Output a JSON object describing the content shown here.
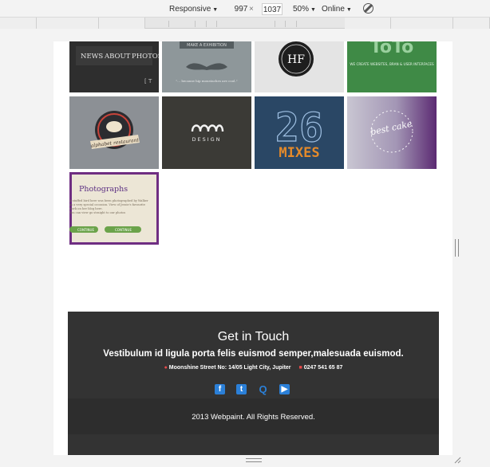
{
  "toolbar": {
    "device": "Responsive",
    "width": "997",
    "separator": "×",
    "height": "1037",
    "zoom": "50%",
    "network": "Online"
  },
  "tiles": {
    "nav_news": "NEWS",
    "nav_about": "ABOUT",
    "nav_photos": "PHOTOS",
    "nav_trunc": "[ T",
    "banner_text": "MAKE A EXHIBITION",
    "mustache_text": "\"... because hip moustaches are cool.\"",
    "hf_logo": "HF",
    "green_brand": "ToTo",
    "green_text": "WE CREATE WEBSITES, BRAN & USER INTERFACES",
    "badge_text": "alphabet restaurant",
    "design_word": "DESIGN",
    "mixes_number": "26",
    "mixes_word": "MIXES",
    "script_text": "best cake",
    "photographs_title": "Photographs",
    "photographs_body": "A stuffed bird here was been photographed by Walker as a very special occasion. View of Jessie's favourite work on her blog here.",
    "photographs_small": "You can view go straight to our photos",
    "btn_left": "CONTINUE",
    "btn_right": "CONTINUE"
  },
  "footer": {
    "title": "Get in Touch",
    "subtitle": "Vestibulum id ligula porta felis euismod semper,malesuada euismod.",
    "address": "Moonshine Street No: 14/05 Light City, Jupiter",
    "phone": "0247 541 65 87",
    "socials": [
      "facebook-icon",
      "twitter-icon",
      "quora-icon",
      "youtube-icon"
    ],
    "copyright": "2013 Webpaint. All Rights Reserved."
  },
  "colors": {
    "footer_bg": "#333333",
    "social_blue": "#2b80d8",
    "accent_red": "#e84a4a",
    "green_tile": "#3f8a46",
    "navy_tile": "#2a4765",
    "mixes_orange": "#e58a2a"
  }
}
